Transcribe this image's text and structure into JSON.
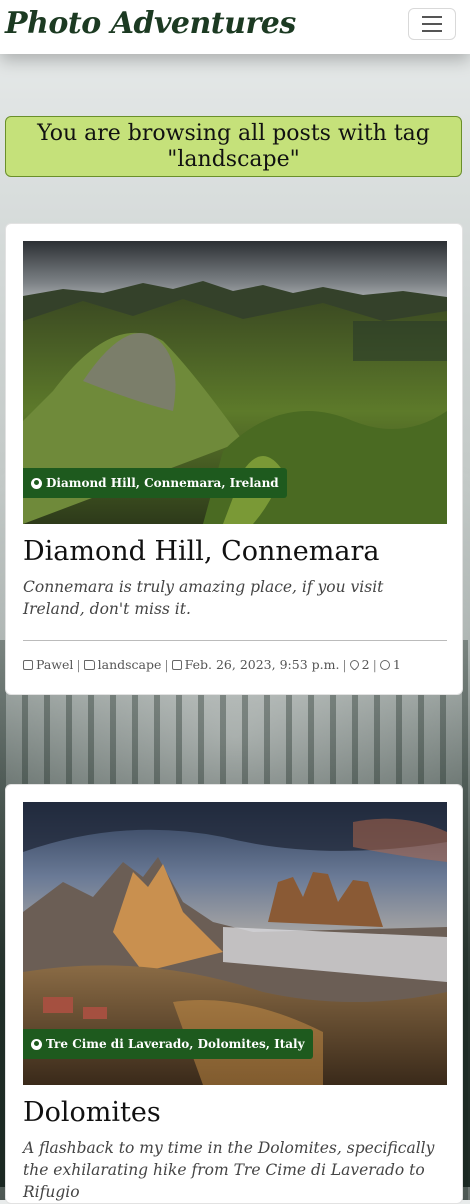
{
  "nav": {
    "brand": "Photo Adventures",
    "toggler_icon": "hamburger-menu-icon"
  },
  "tag_banner": {
    "text": "You are browsing all posts with tag \"landscape\""
  },
  "posts": [
    {
      "location": "Diamond Hill, Connemara, Ireland",
      "title": "Diamond Hill, Connemara",
      "excerpt": "Connemara is truly amazing place, if you visit Ireland, don't miss it.",
      "author": "Pawel",
      "tag": "landscape",
      "date": "Feb. 26, 2023, 9:53 p.m.",
      "likes": "2",
      "comments": "1"
    },
    {
      "location": "Tre Cime di Laverado, Dolomites, Italy",
      "title": "Dolomites",
      "excerpt": "A flashback to my time in the Dolomites, specifically the exhilarating hike from Tre Cime di Laverado to Rifugio"
    }
  ]
}
